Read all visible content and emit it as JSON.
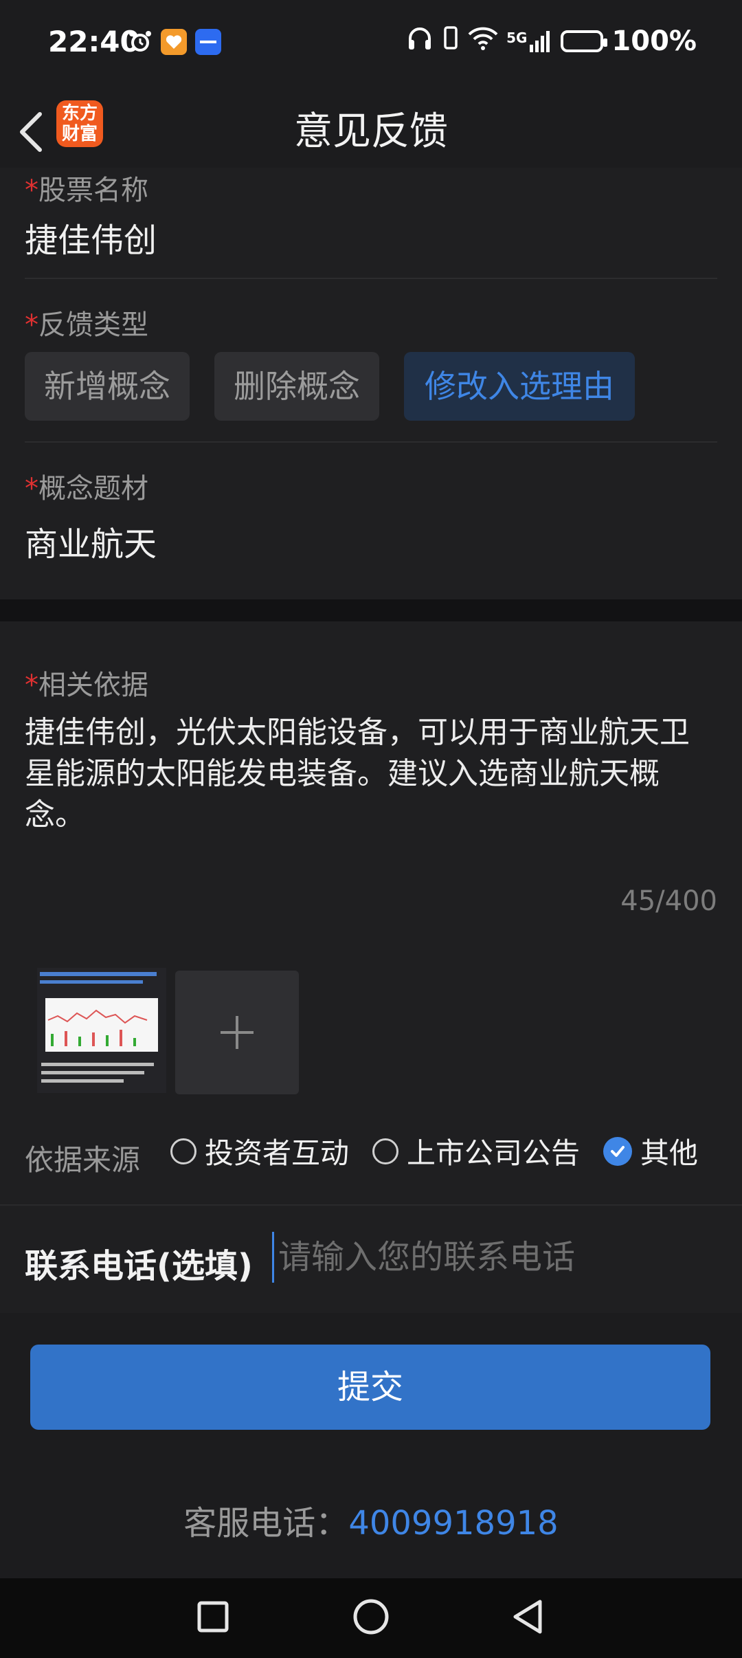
{
  "status_bar": {
    "time": "22:40",
    "network": "5G",
    "battery": "100%"
  },
  "header": {
    "title": "意见反馈",
    "logo_line1": "东方",
    "logo_line2": "财富"
  },
  "form": {
    "required_mark": "*",
    "stock_name": {
      "label": "股票名称",
      "value": "捷佳伟创"
    },
    "feedback_type": {
      "label": "反馈类型",
      "options": [
        "新增概念",
        "删除概念",
        "修改入选理由"
      ],
      "selected": "修改入选理由"
    },
    "concept": {
      "label": "概念题材",
      "value": "商业航天"
    },
    "basis": {
      "label": "相关依据",
      "text": "捷佳伟创，光伏太阳能设备，可以用于商业航天卫星能源的太阳能发电装备。建议入选商业航天概念。",
      "counter": "45/400"
    },
    "source": {
      "label": "依据来源",
      "options": [
        "投资者互动",
        "上市公司公告",
        "其他"
      ],
      "selected": "其他"
    },
    "phone": {
      "label": "联系电话(选填)",
      "placeholder": "请输入您的联系电话",
      "value": ""
    },
    "submit_label": "提交"
  },
  "service": {
    "label": "客服电话：",
    "number": "4009918918"
  },
  "colors": {
    "accent": "#3f86e6",
    "required": "#e03131",
    "logo": "#f05a1f"
  }
}
